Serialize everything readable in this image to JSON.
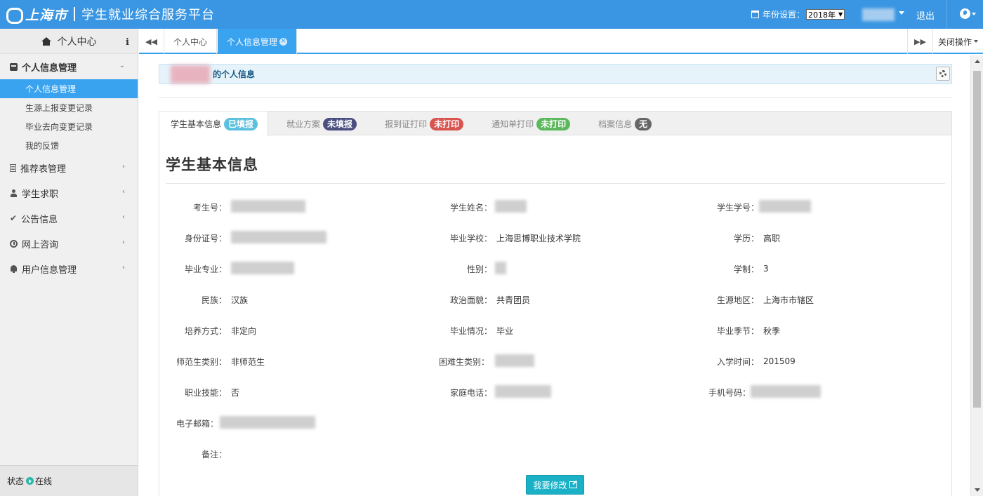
{
  "header": {
    "logo_text": "上海市",
    "app_title": "学生就业综合服务平台",
    "year_label": "年份设置：",
    "year_value": "2018年",
    "logout": "退出"
  },
  "sidebar": {
    "title": "个人中心",
    "groups": [
      {
        "label": "个人信息管理",
        "open": true,
        "items": [
          "个人信息管理",
          "生源上报变更记录",
          "毕业去向变更记录",
          "我的反馈"
        ]
      },
      {
        "label": "推荐表管理"
      },
      {
        "label": "学生求职"
      },
      {
        "label": "公告信息"
      },
      {
        "label": "网上咨询"
      },
      {
        "label": "用户信息管理"
      }
    ],
    "status_label": "状态",
    "status_value": "在线"
  },
  "tabs": {
    "items": [
      "个人中心",
      "个人信息管理"
    ],
    "close_ops": "关闭操作"
  },
  "content": {
    "panel_title": "的个人信息",
    "info_tabs": [
      {
        "label": "学生基本信息",
        "badge": "已填报",
        "color": "#5bc0de"
      },
      {
        "label": "就业方案",
        "badge": "未填报",
        "color": "#4b4f80"
      },
      {
        "label": "报到证打印",
        "badge": "未打印",
        "color": "#d9534f"
      },
      {
        "label": "通知单打印",
        "badge": "未打印",
        "color": "#5cb85c"
      },
      {
        "label": "档案信息",
        "badge": "无",
        "color": "#666666"
      }
    ],
    "section_title": "学生基本信息",
    "fields": {
      "exam_no": {
        "label": "考生号："
      },
      "name": {
        "label": "学生姓名："
      },
      "student_no": {
        "label": "学生学号："
      },
      "id_no": {
        "label": "身份证号："
      },
      "school": {
        "label": "毕业学校：",
        "value": "上海思博职业技术学院"
      },
      "degree": {
        "label": "学历：",
        "value": "高职"
      },
      "major": {
        "label": "毕业专业："
      },
      "gender": {
        "label": "性别："
      },
      "duration": {
        "label": "学制：",
        "value": "3"
      },
      "ethnicity": {
        "label": "民族：",
        "value": "汉族"
      },
      "politics": {
        "label": "政治面貌：",
        "value": "共青团员"
      },
      "origin": {
        "label": "生源地区：",
        "value": "上海市市辖区"
      },
      "training": {
        "label": "培养方式：",
        "value": "非定向"
      },
      "grad_status": {
        "label": "毕业情况：",
        "value": "毕业"
      },
      "grad_season": {
        "label": "毕业季节：",
        "value": "秋季"
      },
      "normal_type": {
        "label": "师范生类别：",
        "value": "非师范生"
      },
      "hardship": {
        "label": "困难生类别："
      },
      "enroll_time": {
        "label": "入学时间：",
        "value": "201509"
      },
      "skill": {
        "label": "职业技能：",
        "value": "否"
      },
      "home_phone": {
        "label": "家庭电话："
      },
      "mobile": {
        "label": "手机号码："
      },
      "email": {
        "label": "电子邮箱："
      },
      "remark": {
        "label": "备注："
      }
    },
    "edit_button": "我要修改"
  }
}
